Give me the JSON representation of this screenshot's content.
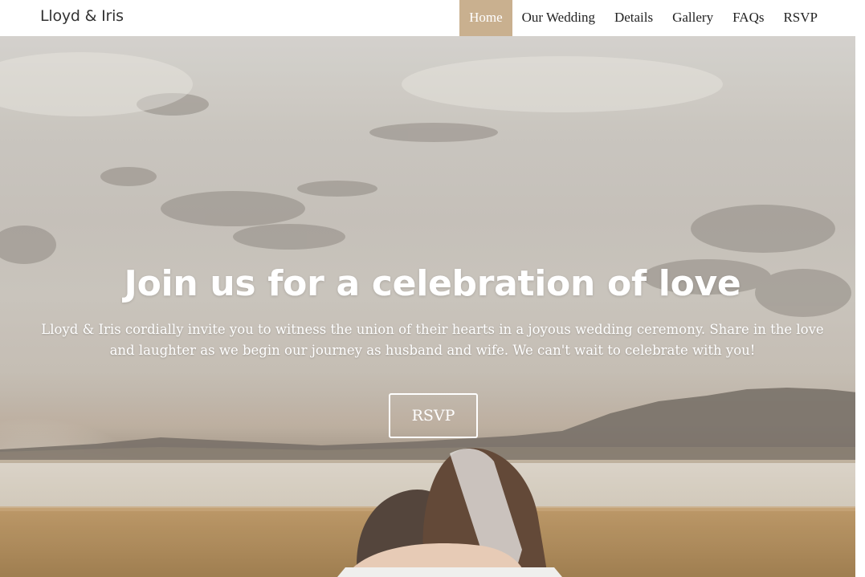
{
  "brand": {
    "name": "Lloyd & Iris"
  },
  "nav": {
    "items": [
      {
        "label": "Home",
        "active": true
      },
      {
        "label": "Our Wedding",
        "active": false
      },
      {
        "label": "Details",
        "active": false
      },
      {
        "label": "Gallery",
        "active": false
      },
      {
        "label": "FAQs",
        "active": false
      },
      {
        "label": "RSVP",
        "active": false
      }
    ]
  },
  "hero": {
    "headline": "Join us for a celebration of love",
    "subtext": "Lloyd & Iris cordially invite you to witness the union of their hearts in a joyous wedding ceremony. Share in the love and laughter as we begin our journey as husband and wife. We can't wait to celebrate with you!",
    "cta_label": "RSVP",
    "background_image": "couple-embracing-by-lake-photo"
  },
  "colors": {
    "accent": "#c9b08f",
    "nav_text": "#222222",
    "brand_text": "#333333",
    "hero_text": "#ffffff"
  }
}
